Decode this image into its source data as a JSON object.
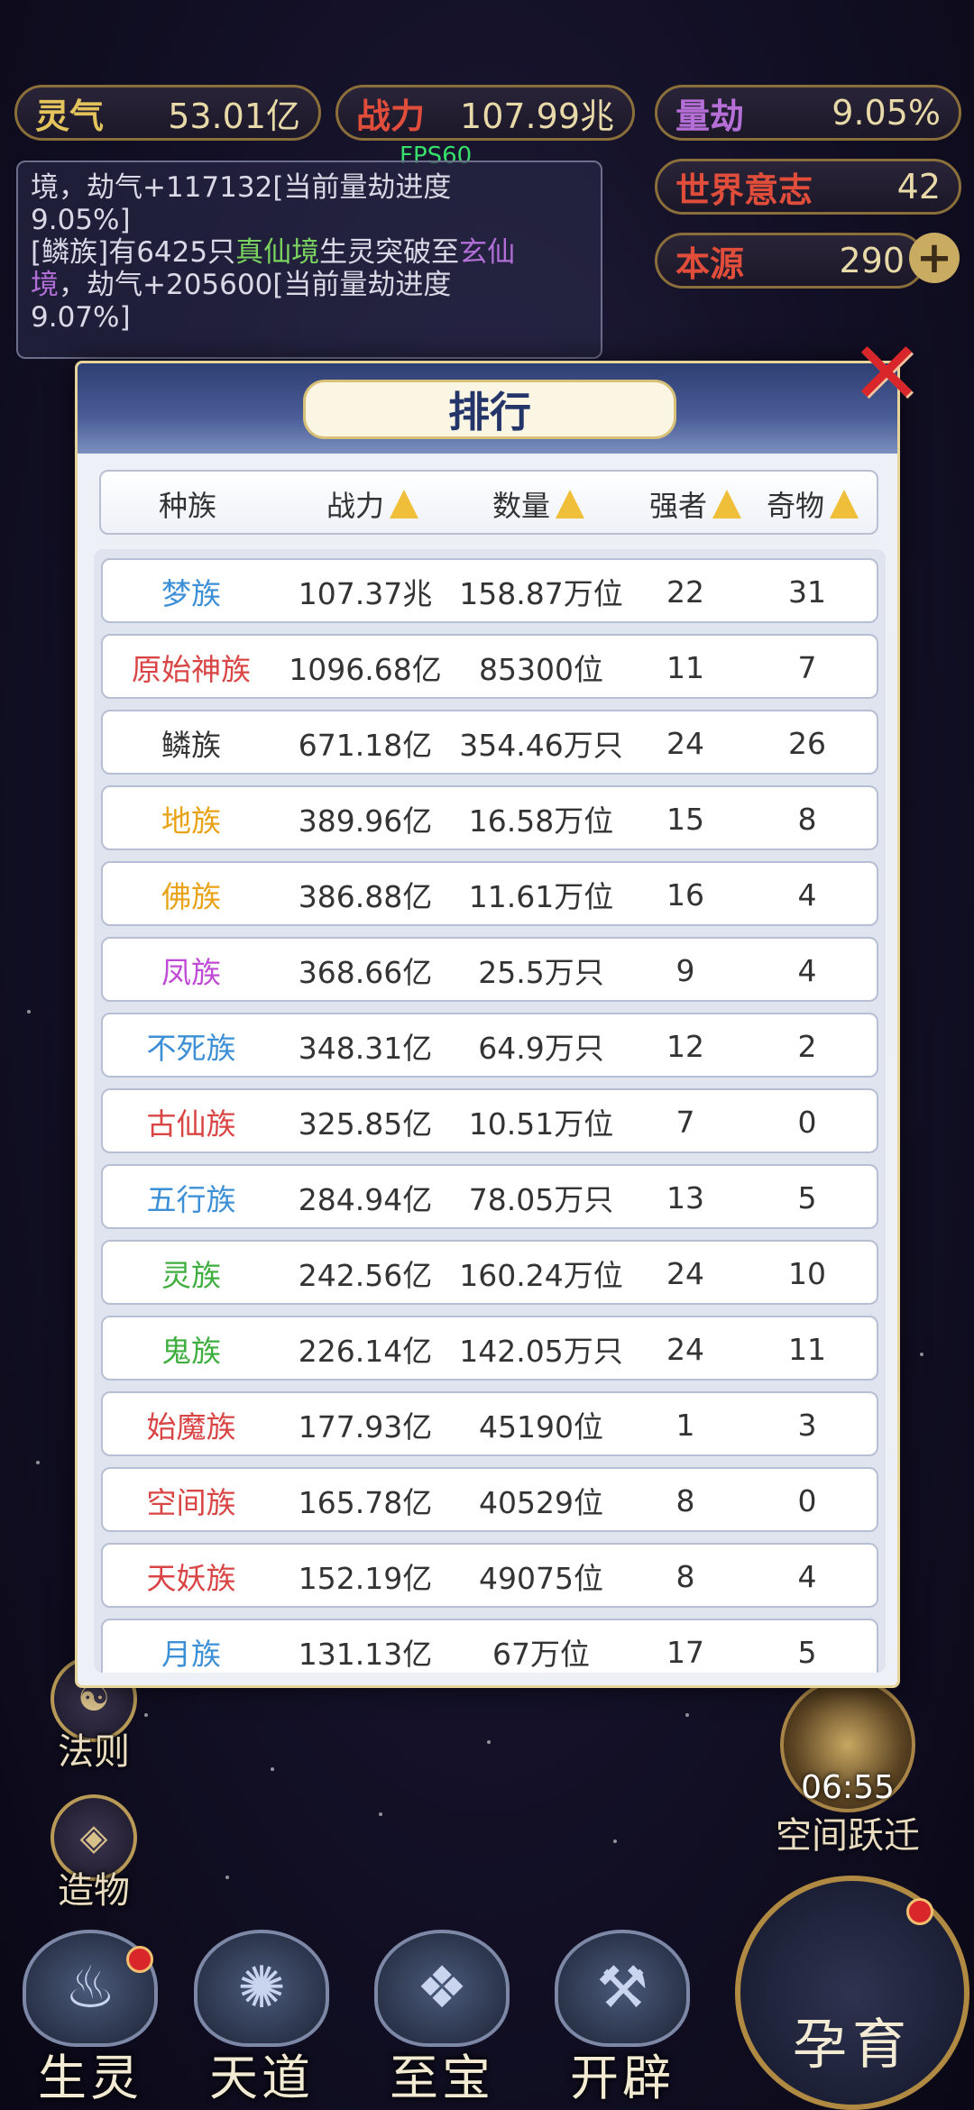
{
  "hud": {
    "lingqi": {
      "label": "灵气",
      "value": "53.01亿"
    },
    "zhanli": {
      "label": "战力",
      "value": "107.99兆"
    },
    "liangjie": {
      "label": "量劫",
      "value": "9.05%"
    },
    "shijie": {
      "label": "世界意志",
      "value": "42"
    },
    "benyuan": {
      "label": "本源",
      "value": "290"
    },
    "fps": "FPS60",
    "plus": "+"
  },
  "log": {
    "line1": "境，劫气+117132[当前量劫进度",
    "line2": "9.05%]",
    "line3_a": "[鳞族]有6425只",
    "line3_b": "真仙境",
    "line3_c": "生灵突破至",
    "line3_d": "玄仙",
    "line4_a": "境",
    "line4_b": "，劫气+205600[当前量劫进度",
    "line5": "9.07%]"
  },
  "side_buttons": {
    "fa_ze": "法则",
    "zao_wu": "造物"
  },
  "jump": {
    "time": "06:55",
    "label": "空间跃迁"
  },
  "bottom_nav": [
    {
      "label": "生灵",
      "icon": "flame-emblem"
    },
    {
      "label": "天道",
      "icon": "swirl-emblem"
    },
    {
      "label": "至宝",
      "icon": "gem-emblem"
    },
    {
      "label": "开辟",
      "icon": "axe-emblem"
    }
  ],
  "big_button": {
    "label": "孕育"
  },
  "modal": {
    "title": "排行",
    "close": "✕",
    "columns": [
      "种族",
      "战力",
      "数量",
      "强者",
      "奇物"
    ],
    "rows": [
      {
        "name": "梦族",
        "color": "#3d8fd6",
        "power": "107.37兆",
        "count": "158.87万位",
        "strong": "22",
        "treasure": "31"
      },
      {
        "name": "原始神族",
        "color": "#d94545",
        "power": "1096.68亿",
        "count": "85300位",
        "strong": "11",
        "treasure": "7"
      },
      {
        "name": "鳞族",
        "color": "#333333",
        "power": "671.18亿",
        "count": "354.46万只",
        "strong": "24",
        "treasure": "26"
      },
      {
        "name": "地族",
        "color": "#e8a318",
        "power": "389.96亿",
        "count": "16.58万位",
        "strong": "15",
        "treasure": "8"
      },
      {
        "name": "佛族",
        "color": "#e8a318",
        "power": "386.88亿",
        "count": "11.61万位",
        "strong": "16",
        "treasure": "4"
      },
      {
        "name": "凤族",
        "color": "#c04ad6",
        "power": "368.66亿",
        "count": "25.5万只",
        "strong": "9",
        "treasure": "4"
      },
      {
        "name": "不死族",
        "color": "#3d8fd6",
        "power": "348.31亿",
        "count": "64.9万只",
        "strong": "12",
        "treasure": "2"
      },
      {
        "name": "古仙族",
        "color": "#d94545",
        "power": "325.85亿",
        "count": "10.51万位",
        "strong": "7",
        "treasure": "0"
      },
      {
        "name": "五行族",
        "color": "#3d8fd6",
        "power": "284.94亿",
        "count": "78.05万只",
        "strong": "13",
        "treasure": "5"
      },
      {
        "name": "灵族",
        "color": "#3fae3f",
        "power": "242.56亿",
        "count": "160.24万位",
        "strong": "24",
        "treasure": "10"
      },
      {
        "name": "鬼族",
        "color": "#3fae3f",
        "power": "226.14亿",
        "count": "142.05万只",
        "strong": "24",
        "treasure": "11"
      },
      {
        "name": "始魔族",
        "color": "#d94545",
        "power": "177.93亿",
        "count": "45190位",
        "strong": "1",
        "treasure": "3"
      },
      {
        "name": "空间族",
        "color": "#d94545",
        "power": "165.78亿",
        "count": "40529位",
        "strong": "8",
        "treasure": "0"
      },
      {
        "name": "天妖族",
        "color": "#d94545",
        "power": "152.19亿",
        "count": "49075位",
        "strong": "8",
        "treasure": "4"
      },
      {
        "name": "月族",
        "color": "#3d8fd6",
        "power": "131.13亿",
        "count": "67万位",
        "strong": "17",
        "treasure": "5"
      }
    ]
  }
}
